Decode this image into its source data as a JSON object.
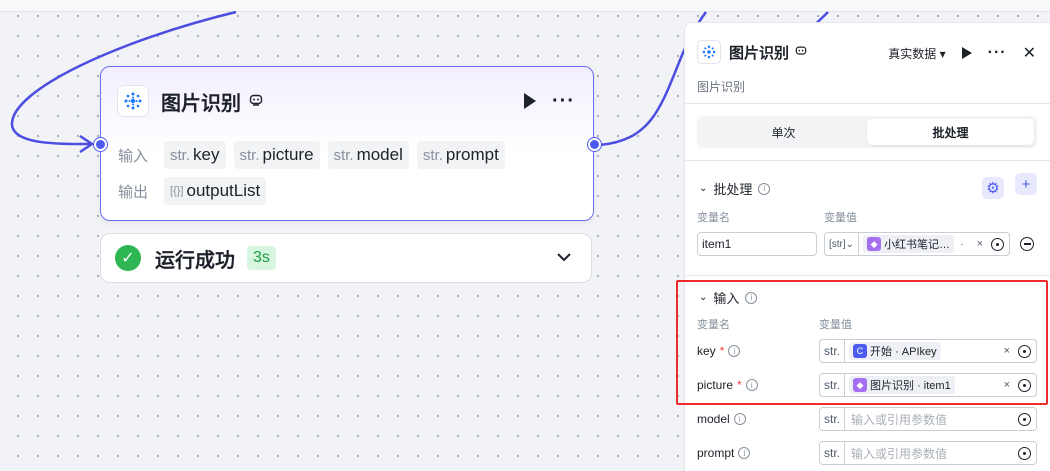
{
  "node": {
    "title": "图片识别",
    "input_label": "输入",
    "output_label": "输出",
    "inputs": [
      {
        "type": "str.",
        "name": "key"
      },
      {
        "type": "str.",
        "name": "picture"
      },
      {
        "type": "str.",
        "name": "model"
      },
      {
        "type": "str.",
        "name": "prompt"
      }
    ],
    "outputs": [
      {
        "type": "[{}]",
        "name": "outputList"
      }
    ],
    "more": "···"
  },
  "status": {
    "text": "运行成功",
    "time": "3s"
  },
  "panel": {
    "title": "图片识别",
    "subtitle": "图片识别",
    "data_mode": "真实数据",
    "tabs": [
      "单次",
      "批处理"
    ],
    "active_tab": "批处理",
    "batch": {
      "title": "批处理",
      "col_name": "变量名",
      "col_value": "变量值",
      "item_name": "item1",
      "item_type": "[str]",
      "item_ref": "小红书笔记…",
      "item_ref_suffix": "·",
      "add": "+"
    },
    "input": {
      "title": "输入",
      "col_name": "变量名",
      "col_value": "变量值",
      "rows": [
        {
          "name": "key",
          "required": true,
          "type": "str.",
          "ref": "开始 · APIkey",
          "placeholder": ""
        },
        {
          "name": "picture",
          "required": true,
          "type": "str.",
          "ref": "图片识别 · item1",
          "placeholder": ""
        },
        {
          "name": "model",
          "required": false,
          "type": "str.",
          "ref": "",
          "placeholder": "输入或引用参数值"
        },
        {
          "name": "prompt",
          "required": false,
          "type": "str.",
          "ref": "",
          "placeholder": "输入或引用参数值"
        }
      ]
    }
  },
  "colors": {
    "accent": "#4e5bf0",
    "wire": "#4b4ee0",
    "annotation_red": "#ee2b2b",
    "success": "#2fb755"
  }
}
